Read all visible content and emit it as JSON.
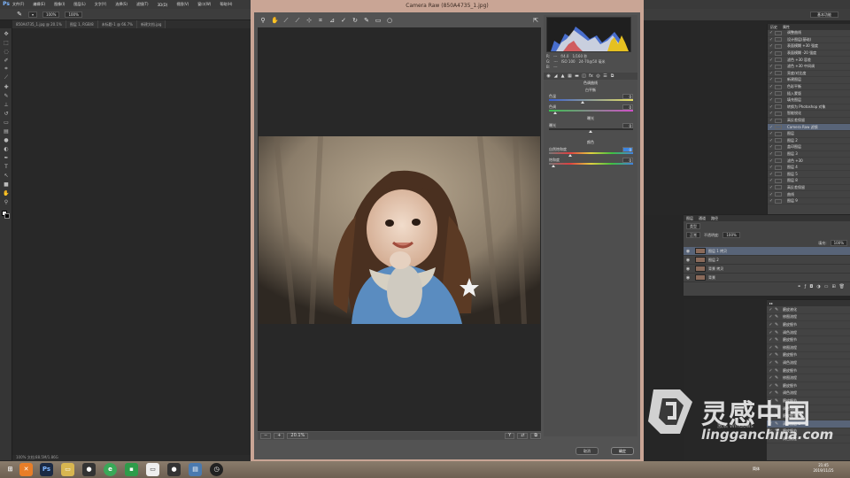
{
  "photoshop": {
    "logo": "Ps",
    "menu": [
      "文件(F)",
      "编辑(E)",
      "图像(I)",
      "图层(L)",
      "文字(Y)",
      "选择(S)",
      "滤镜(T)",
      "3D(D)",
      "视图(V)",
      "窗口(W)",
      "帮助(H)"
    ],
    "options": {
      "opacity": "100%",
      "flow": "100%"
    },
    "doc_tabs": [
      "850A4735_1.jpg @ 20.1%",
      "图层 1, RGB/8",
      "未标题-1 @ 66.7%",
      "新建文档.jpg"
    ],
    "status": "100% 文档:88.5M/1.86G",
    "workspace": "基本功能"
  },
  "history": {
    "tabs": [
      "历史",
      "属性"
    ],
    "items": [
      "调整曲线",
      "设计图层(基础)",
      "表面模糊 +30 强度",
      "表面模糊 -20 强度",
      "滤色 +30 容差",
      "滤色 +30 中间调",
      "亮度/对比度",
      "新建图层",
      "色彩平衡",
      "插入蒙版",
      "填充图层",
      "转换为 Photoshop 对象",
      "智能锐化",
      "高反差保留",
      "Camera Raw 滤镜",
      "图层",
      "图层 2",
      "盖印图层",
      "图层 3",
      "滤色 +30",
      "图层 4",
      "图层 5",
      "图层 8",
      "高反差保留",
      "曲线",
      "图层 9"
    ],
    "selected_index": 14
  },
  "layers": {
    "tabs": [
      "图层",
      "通道",
      "路径"
    ],
    "kind": "类型",
    "blend": "正常",
    "opacity_label": "不透明度:",
    "opacity": "100%",
    "fill_label": "填充:",
    "fill": "100%",
    "rows": [
      "图层 1 拷贝",
      "图层 2",
      "背景 拷贝",
      "背景"
    ],
    "selected_index": 0
  },
  "actions": {
    "items": [
      "磨皮液化",
      "修图流程",
      "磨皮细节",
      "调色流程",
      "磨皮细节",
      "修图流程",
      "磨皮细节",
      "调色流程",
      "磨皮细节",
      "修图流程",
      "磨皮细节",
      "调色流程",
      "磨皮细节",
      "调色流程",
      "磨皮细节",
      "清除图层 C",
      "磨皮细节",
      "调色流程"
    ],
    "selected_index": 15
  },
  "camera_raw": {
    "title": "Camera Raw (850A4735_1.jpg)",
    "readout": {
      "r_label": "R:",
      "g_label": "G:",
      "b_label": "B:",
      "r": "---",
      "g": "---",
      "b": "---",
      "f": "f/4.0",
      "shutter": "1/160 秒",
      "iso": "ISO 100",
      "lens": "24-70@50 毫米"
    },
    "panel_title": "色调曲线",
    "sections": [
      {
        "title": "白平衡",
        "sliders": [
          {
            "label": "色温",
            "value": "0"
          },
          {
            "label": "色调",
            "value": "0"
          }
        ]
      },
      {
        "title": "曝光",
        "sliders": [
          {
            "label": "曝光",
            "value": "0"
          }
        ]
      },
      {
        "title": "颜色",
        "sliders": [
          {
            "label": "自然饱和度",
            "value": "0"
          },
          {
            "label": "饱和度",
            "value": "0"
          }
        ]
      }
    ],
    "zoom": "20.1%",
    "cancel": "取消",
    "ok": "确定"
  },
  "taskbar": {
    "time": "21:45",
    "date": "2019/11/25",
    "ime": "简体"
  },
  "watermark": {
    "brand": "灵感中国",
    "url": "lingganchina.com",
    "win": "激活 Windows"
  }
}
